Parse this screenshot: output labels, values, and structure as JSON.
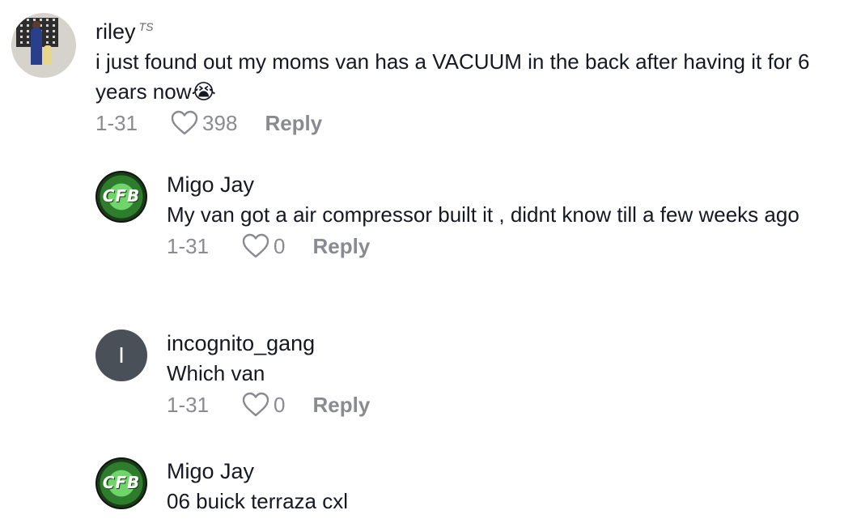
{
  "comments": [
    {
      "username": "riley",
      "badge": "TS",
      "text": "i just found out my moms van has a VACUUM in the back after having it for 6 years now😭",
      "date": "1-31",
      "likes": "398",
      "reply_label": "Reply"
    },
    {
      "username": "Migo Jay",
      "avatar_text": "CFB",
      "text": "My van got a air compressor built it , didnt know till a few weeks ago",
      "date": "1-31",
      "likes": "0",
      "reply_label": "Reply"
    },
    {
      "username": "incognito_gang",
      "avatar_text": "I",
      "text": "Which van",
      "date": "1-31",
      "likes": "0",
      "reply_label": "Reply"
    },
    {
      "username": "Migo Jay",
      "avatar_text": "CFB",
      "text": "06 buick terraza cxl"
    }
  ],
  "icons": {
    "like": "heart-outline-icon"
  },
  "colors": {
    "text": "#161823",
    "meta": "#8a8b91",
    "avatar_gray": "#4a5058"
  }
}
